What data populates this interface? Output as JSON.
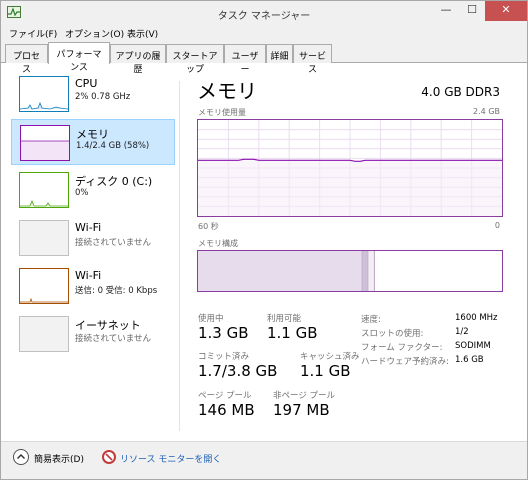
{
  "window": {
    "title": "タスク マネージャー"
  },
  "menu": [
    "ファイル(F)",
    "オプション(O)",
    "表示(V)"
  ],
  "tabs": [
    {
      "label": "プロセス"
    },
    {
      "label": "パフォーマンス"
    },
    {
      "label": "アプリの履歴"
    },
    {
      "label": "スタートアップ"
    },
    {
      "label": "ユーザー"
    },
    {
      "label": "詳細"
    },
    {
      "label": "サービス"
    }
  ],
  "active_tab": "パフォーマンス",
  "sidebar": {
    "items": [
      {
        "name": "CPU",
        "sub": "2%  0.78 GHz",
        "color": "#117dbb"
      },
      {
        "name": "メモリ",
        "sub": "1.4/2.4 GB (58%)",
        "color": "#8b12ae",
        "selected": true
      },
      {
        "name": "ディスク 0 (C:)",
        "sub": "0%",
        "color": "#4da60c"
      },
      {
        "name": "Wi-Fi",
        "sub": "接続されていません",
        "color": "#c0c0c0"
      },
      {
        "name": "Wi-Fi",
        "sub": "送信: 0  受信: 0 Kbps",
        "color": "#a74f01"
      },
      {
        "name": "イーサネット",
        "sub": "接続されていません",
        "color": "#c0c0c0"
      }
    ]
  },
  "memory": {
    "title": "メモリ",
    "spec": "4.0 GB DDR3",
    "usage_label": "メモリ使用量",
    "usage_max": "2.4 GB",
    "time_left": "60 秒",
    "time_right": "0",
    "composition_label": "メモリ構成",
    "graph_level": 0.58,
    "composition": {
      "in_use": 0.54,
      "modified": 0.02,
      "standby": 0.02
    },
    "stats": {
      "in_use_label": "使用中",
      "in_use": "1.3 GB",
      "available_label": "利用可能",
      "available": "1.1 GB",
      "committed_label": "コミット済み",
      "committed": "1.7/3.8 GB",
      "cached_label": "キャッシュ済み",
      "cached": "1.1 GB",
      "paged_label": "ページ プール",
      "paged": "146 MB",
      "nonpaged_label": "非ページ プール",
      "nonpaged": "197 MB"
    },
    "specs": {
      "speed_label": "速度:",
      "speed": "1600 MHz",
      "slots_label": "スロットの使用:",
      "slots": "1/2",
      "form_label": "フォーム ファクター:",
      "form": "SODIMM",
      "reserved_label": "ハードウェア予約済み:",
      "reserved": "1.6 GB"
    }
  },
  "footer": {
    "fewer_details": "簡易表示(D)",
    "resource_monitor": "リソース モニターを開く"
  },
  "colors": {
    "memory_accent": "#8b12ae",
    "selection_bg": "#cce8ff"
  }
}
